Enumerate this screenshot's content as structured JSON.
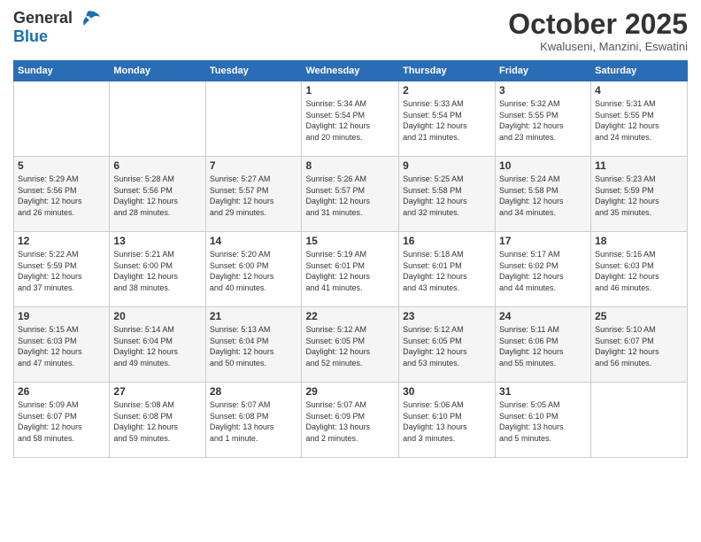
{
  "header": {
    "logo_general": "General",
    "logo_blue": "Blue",
    "month": "October 2025",
    "location": "Kwaluseni, Manzini, Eswatini"
  },
  "weekdays": [
    "Sunday",
    "Monday",
    "Tuesday",
    "Wednesday",
    "Thursday",
    "Friday",
    "Saturday"
  ],
  "weeks": [
    [
      {
        "day": "",
        "info": ""
      },
      {
        "day": "",
        "info": ""
      },
      {
        "day": "",
        "info": ""
      },
      {
        "day": "1",
        "info": "Sunrise: 5:34 AM\nSunset: 5:54 PM\nDaylight: 12 hours\nand 20 minutes."
      },
      {
        "day": "2",
        "info": "Sunrise: 5:33 AM\nSunset: 5:54 PM\nDaylight: 12 hours\nand 21 minutes."
      },
      {
        "day": "3",
        "info": "Sunrise: 5:32 AM\nSunset: 5:55 PM\nDaylight: 12 hours\nand 23 minutes."
      },
      {
        "day": "4",
        "info": "Sunrise: 5:31 AM\nSunset: 5:55 PM\nDaylight: 12 hours\nand 24 minutes."
      }
    ],
    [
      {
        "day": "5",
        "info": "Sunrise: 5:29 AM\nSunset: 5:56 PM\nDaylight: 12 hours\nand 26 minutes."
      },
      {
        "day": "6",
        "info": "Sunrise: 5:28 AM\nSunset: 5:56 PM\nDaylight: 12 hours\nand 28 minutes."
      },
      {
        "day": "7",
        "info": "Sunrise: 5:27 AM\nSunset: 5:57 PM\nDaylight: 12 hours\nand 29 minutes."
      },
      {
        "day": "8",
        "info": "Sunrise: 5:26 AM\nSunset: 5:57 PM\nDaylight: 12 hours\nand 31 minutes."
      },
      {
        "day": "9",
        "info": "Sunrise: 5:25 AM\nSunset: 5:58 PM\nDaylight: 12 hours\nand 32 minutes."
      },
      {
        "day": "10",
        "info": "Sunrise: 5:24 AM\nSunset: 5:58 PM\nDaylight: 12 hours\nand 34 minutes."
      },
      {
        "day": "11",
        "info": "Sunrise: 5:23 AM\nSunset: 5:59 PM\nDaylight: 12 hours\nand 35 minutes."
      }
    ],
    [
      {
        "day": "12",
        "info": "Sunrise: 5:22 AM\nSunset: 5:59 PM\nDaylight: 12 hours\nand 37 minutes."
      },
      {
        "day": "13",
        "info": "Sunrise: 5:21 AM\nSunset: 6:00 PM\nDaylight: 12 hours\nand 38 minutes."
      },
      {
        "day": "14",
        "info": "Sunrise: 5:20 AM\nSunset: 6:00 PM\nDaylight: 12 hours\nand 40 minutes."
      },
      {
        "day": "15",
        "info": "Sunrise: 5:19 AM\nSunset: 6:01 PM\nDaylight: 12 hours\nand 41 minutes."
      },
      {
        "day": "16",
        "info": "Sunrise: 5:18 AM\nSunset: 6:01 PM\nDaylight: 12 hours\nand 43 minutes."
      },
      {
        "day": "17",
        "info": "Sunrise: 5:17 AM\nSunset: 6:02 PM\nDaylight: 12 hours\nand 44 minutes."
      },
      {
        "day": "18",
        "info": "Sunrise: 5:16 AM\nSunset: 6:03 PM\nDaylight: 12 hours\nand 46 minutes."
      }
    ],
    [
      {
        "day": "19",
        "info": "Sunrise: 5:15 AM\nSunset: 6:03 PM\nDaylight: 12 hours\nand 47 minutes."
      },
      {
        "day": "20",
        "info": "Sunrise: 5:14 AM\nSunset: 6:04 PM\nDaylight: 12 hours\nand 49 minutes."
      },
      {
        "day": "21",
        "info": "Sunrise: 5:13 AM\nSunset: 6:04 PM\nDaylight: 12 hours\nand 50 minutes."
      },
      {
        "day": "22",
        "info": "Sunrise: 5:12 AM\nSunset: 6:05 PM\nDaylight: 12 hours\nand 52 minutes."
      },
      {
        "day": "23",
        "info": "Sunrise: 5:12 AM\nSunset: 6:05 PM\nDaylight: 12 hours\nand 53 minutes."
      },
      {
        "day": "24",
        "info": "Sunrise: 5:11 AM\nSunset: 6:06 PM\nDaylight: 12 hours\nand 55 minutes."
      },
      {
        "day": "25",
        "info": "Sunrise: 5:10 AM\nSunset: 6:07 PM\nDaylight: 12 hours\nand 56 minutes."
      }
    ],
    [
      {
        "day": "26",
        "info": "Sunrise: 5:09 AM\nSunset: 6:07 PM\nDaylight: 12 hours\nand 58 minutes."
      },
      {
        "day": "27",
        "info": "Sunrise: 5:08 AM\nSunset: 6:08 PM\nDaylight: 12 hours\nand 59 minutes."
      },
      {
        "day": "28",
        "info": "Sunrise: 5:07 AM\nSunset: 6:08 PM\nDaylight: 13 hours\nand 1 minute."
      },
      {
        "day": "29",
        "info": "Sunrise: 5:07 AM\nSunset: 6:09 PM\nDaylight: 13 hours\nand 2 minutes."
      },
      {
        "day": "30",
        "info": "Sunrise: 5:06 AM\nSunset: 6:10 PM\nDaylight: 13 hours\nand 3 minutes."
      },
      {
        "day": "31",
        "info": "Sunrise: 5:05 AM\nSunset: 6:10 PM\nDaylight: 13 hours\nand 5 minutes."
      },
      {
        "day": "",
        "info": ""
      }
    ]
  ]
}
